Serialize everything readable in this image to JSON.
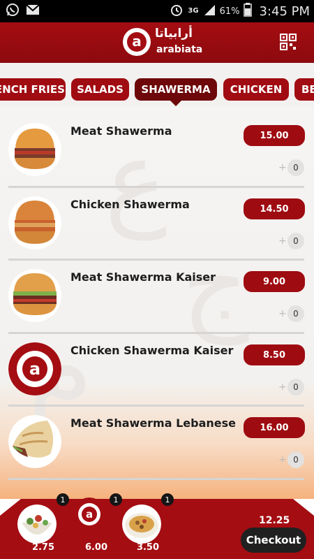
{
  "status_bar": {
    "network": "3G",
    "battery": "61%",
    "time": "3:45 PM"
  },
  "header": {
    "logo_letter": "a",
    "brand_arabic": "أرابياتا",
    "brand_latin": "arabiata",
    "qr_icon": "qr-code-icon"
  },
  "tabs": [
    {
      "label": "FRENCH FRIES",
      "active": false
    },
    {
      "label": "SALADS",
      "active": false
    },
    {
      "label": "SHAWERMA",
      "active": true
    },
    {
      "label": "CHICKEN",
      "active": false
    },
    {
      "label": "BEVERAGES",
      "active": false
    }
  ],
  "items": [
    {
      "name": "Meat Shawerma",
      "price": "15.00",
      "plus": "+",
      "qty": "0",
      "image": "burger-meat"
    },
    {
      "name": "Chicken Shawerma",
      "price": "14.50",
      "plus": "+",
      "qty": "0",
      "image": "burger-chicken"
    },
    {
      "name": "Meat Shawerma Kaiser",
      "price": "9.00",
      "plus": "+",
      "qty": "0",
      "image": "burger-kaiser"
    },
    {
      "name": "Chicken Shawerma Kaiser",
      "price": "8.50",
      "plus": "+",
      "qty": "0",
      "image": "brand-logo"
    },
    {
      "name": "Meat Shawerma Lebanese",
      "price": "16.00",
      "plus": "+",
      "qty": "0",
      "image": "wrap"
    }
  ],
  "cart": {
    "items": [
      {
        "price": "2.75",
        "badge": "1",
        "image": "salad"
      },
      {
        "price": "6.00",
        "badge": "1",
        "image": "brand-logo"
      },
      {
        "price": "3.50",
        "badge": "1",
        "image": "rice"
      }
    ],
    "total": "12.25",
    "checkout_label": "Checkout"
  },
  "colors": {
    "brand_red": "#a40d12",
    "active_tab": "#6d070a",
    "checkout": "#202020"
  }
}
